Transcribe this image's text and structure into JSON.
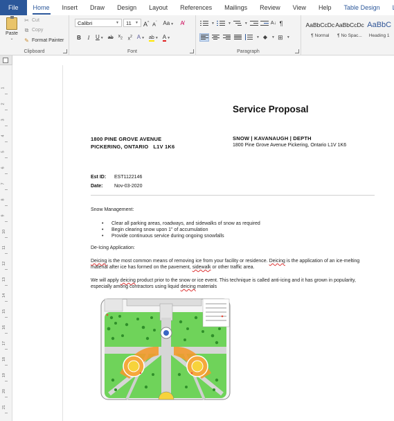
{
  "tabs": [
    {
      "label": "File",
      "type": "file"
    },
    {
      "label": "Home",
      "type": "active"
    },
    {
      "label": "Insert",
      "type": ""
    },
    {
      "label": "Draw",
      "type": ""
    },
    {
      "label": "Design",
      "type": ""
    },
    {
      "label": "Layout",
      "type": ""
    },
    {
      "label": "References",
      "type": ""
    },
    {
      "label": "Mailings",
      "type": ""
    },
    {
      "label": "Review",
      "type": ""
    },
    {
      "label": "View",
      "type": ""
    },
    {
      "label": "Help",
      "type": ""
    },
    {
      "label": "Table Design",
      "type": "ctx"
    },
    {
      "label": "Layout",
      "type": "ctx"
    }
  ],
  "ribbon": {
    "clipboard": {
      "paste": "Paste",
      "cut": "Cut",
      "copy": "Copy",
      "format_painter": "Format Painter",
      "group_label": "Clipboard"
    },
    "font": {
      "name": "Calibri",
      "size": "11",
      "grow": "A",
      "shrink": "A",
      "change_case": "Aa",
      "bold": "B",
      "italic": "I",
      "underline": "U",
      "strike": "ab",
      "subscript": "x",
      "superscript": "x",
      "text_effects": "A",
      "highlight": "ab",
      "font_color": "A",
      "group_label": "Font"
    },
    "paragraph": {
      "sort": "A",
      "pilcrow": "¶",
      "group_label": "Paragraph"
    },
    "styles": [
      {
        "sample": "AaBbCcDc",
        "name": "¶ Normal"
      },
      {
        "sample": "AaBbCcDc",
        "name": "¶ No Spac..."
      },
      {
        "sample": "AaBbC",
        "name": "Heading 1"
      }
    ]
  },
  "ruler": {
    "numbers": [
      "1",
      "2",
      "3",
      "4",
      "5",
      "6",
      "7",
      "8",
      "9",
      "10",
      "11",
      "12",
      "13",
      "14",
      "15",
      "16",
      "17",
      "18",
      "19",
      "20",
      "21",
      "22"
    ]
  },
  "document": {
    "title": "Service Proposal",
    "client_address_line1": "1800 PINE GROVE AVENUE",
    "client_address_line2": "PICKERING, ONTARIO   L1V 1K6",
    "company_name": "SNOW | KAVANAUGH | DEPTH",
    "company_address": "1800 Pine Grove Avenue Pickering, Ontario L1V 1K6",
    "est_id_label": "Est ID:",
    "est_id_value": "EST1122146",
    "date_label": "Date:",
    "date_value": "Nov-03-2020",
    "snow_heading": "Snow Management:",
    "bullets": [
      "Clear all parking areas, roadways, and sidewalks of snow as required",
      "Begin clearing snow upon 1\" of accumulation",
      "Provide continuous service during ongoing snowfalls"
    ],
    "deicing_heading": "De-Icing Application:",
    "p1_w1": "Deicing",
    "p1_t1": " is the most common means of removing ice from your facility or residence. ",
    "p1_w2": "Deicing",
    "p1_t2": " is the application of an ice-melting material after ice has formed on the pavement, ",
    "p1_w3": "sidewalk",
    "p1_t3": " or other traffic area.",
    "p2_t1": "We will apply ",
    "p2_w1": "deicing",
    "p2_t2": " product prior to the snow or ice event. This technique is called anti-icing and it has grown in popularity, especially among contractors using liquid ",
    "p2_w2": "deicing",
    "p2_t3": " materials"
  }
}
